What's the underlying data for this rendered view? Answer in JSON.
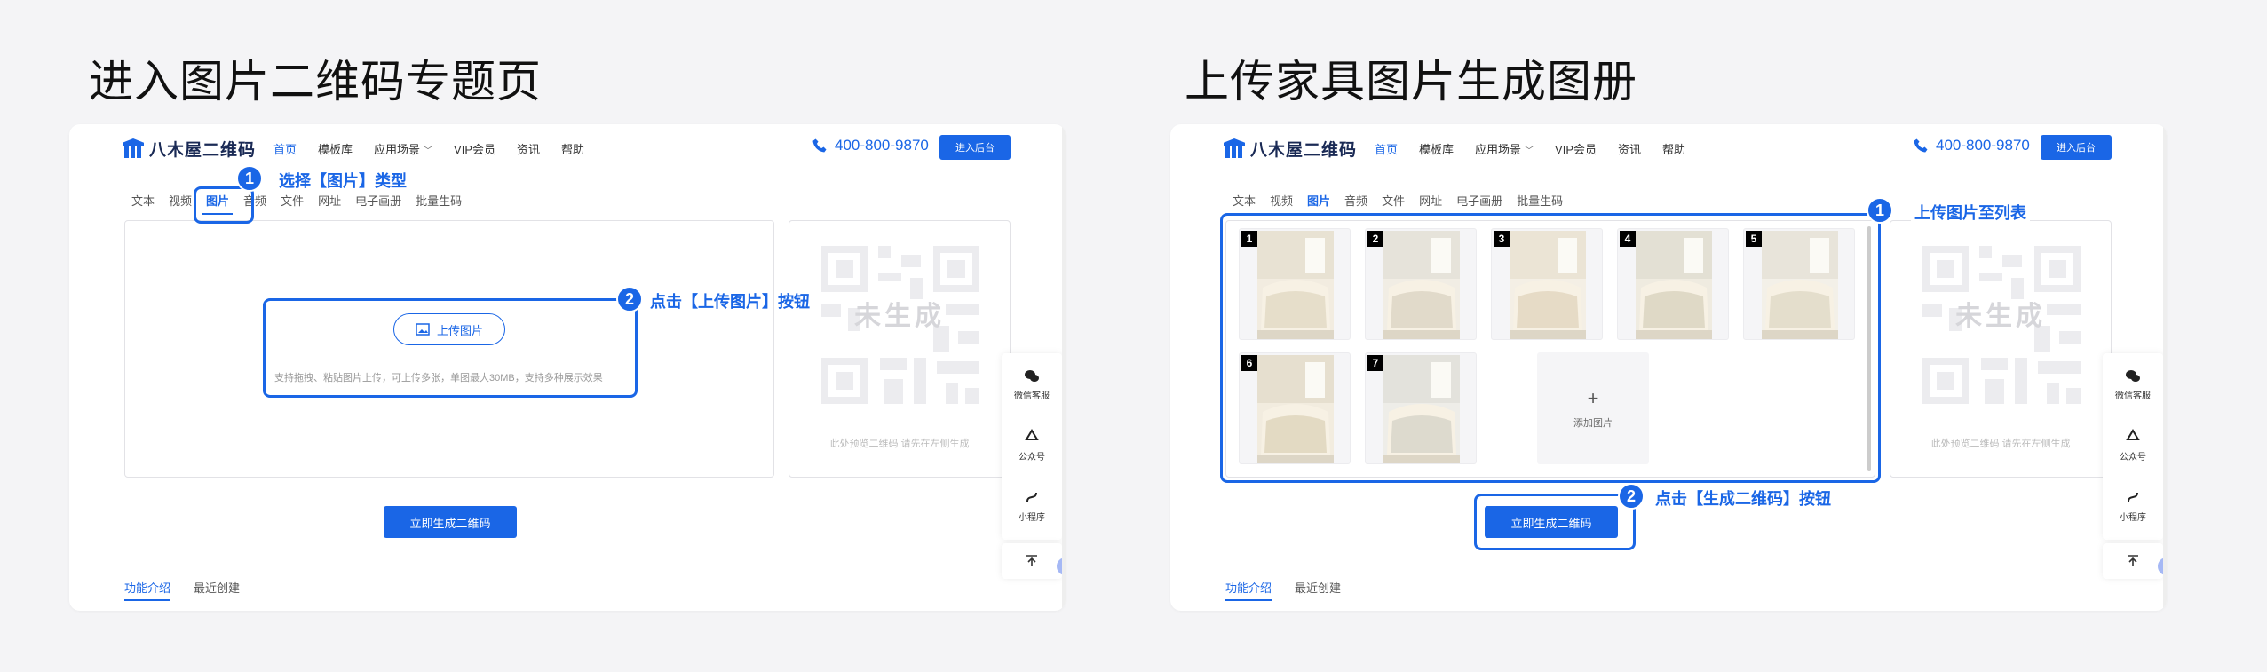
{
  "steps": [
    {
      "title": "进入图片二维码专题页",
      "callouts": [
        {
          "num": "1",
          "text": "选择【图片】类型"
        },
        {
          "num": "2",
          "text": "点击【上传图片】按钮"
        }
      ],
      "upload_button": "上传图片",
      "upload_hint": "支持拖拽、粘贴图片上传，可上传多张，单图最大30MB，支持多种展示效果"
    },
    {
      "title": "上传家具图片生成图册",
      "callouts": [
        {
          "num": "1",
          "text": "上传图片至列表"
        },
        {
          "num": "2",
          "text": "点击【生成二维码】按钮"
        }
      ],
      "thumbnails": [
        "1",
        "2",
        "3",
        "4",
        "5",
        "6",
        "7"
      ],
      "add_label": "添加图片"
    }
  ],
  "header": {
    "logo": "八木屋二维码",
    "nav": [
      "首页",
      "模板库",
      "应用场景",
      "VIP会员",
      "资讯",
      "帮助"
    ],
    "phone": "400-800-9870",
    "enter_button": "进入后台"
  },
  "type_tabs": [
    "文本",
    "视频",
    "图片",
    "音频",
    "文件",
    "网址",
    "电子画册",
    "批量生码"
  ],
  "qr_preview": {
    "label": "未生成",
    "hint": "此处预览二维码 请先在左侧生成"
  },
  "generate_button": "立即生成二维码",
  "bottom_tabs": [
    "功能介绍",
    "最近创建"
  ],
  "side_float": [
    "微信客服",
    "公众号",
    "小程序"
  ],
  "colors": {
    "accent": "#1a66e6"
  }
}
